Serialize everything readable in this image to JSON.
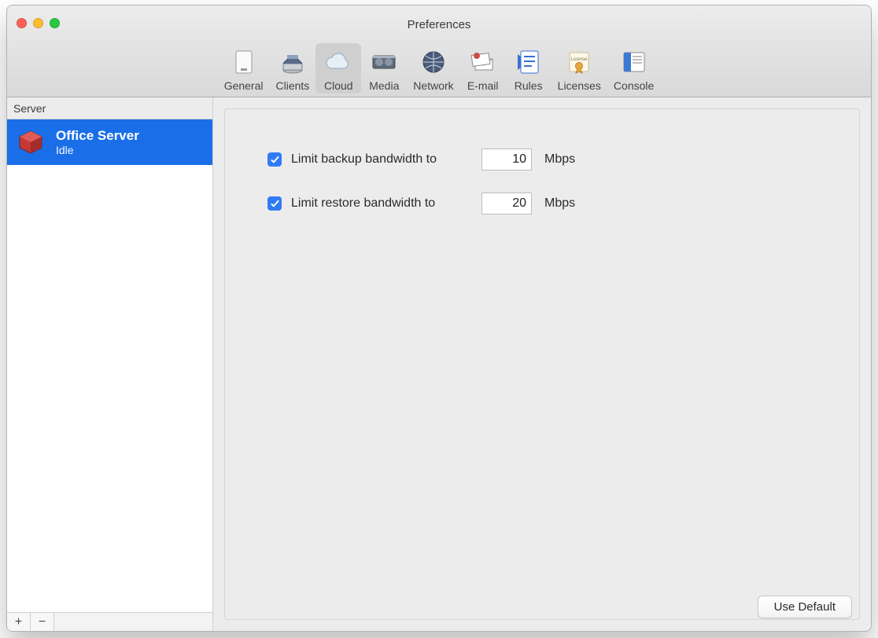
{
  "window": {
    "title": "Preferences"
  },
  "toolbar": {
    "items": [
      {
        "id": "general",
        "label": "General"
      },
      {
        "id": "clients",
        "label": "Clients"
      },
      {
        "id": "cloud",
        "label": "Cloud",
        "selected": true
      },
      {
        "id": "media",
        "label": "Media"
      },
      {
        "id": "network",
        "label": "Network"
      },
      {
        "id": "email",
        "label": "E-mail"
      },
      {
        "id": "rules",
        "label": "Rules"
      },
      {
        "id": "licenses",
        "label": "Licenses"
      },
      {
        "id": "console",
        "label": "Console"
      }
    ]
  },
  "sidebar": {
    "header": "Server",
    "servers": [
      {
        "name": "Office Server",
        "status": "Idle",
        "selected": true
      }
    ],
    "add_label": "+",
    "remove_label": "−"
  },
  "settings": {
    "backup": {
      "checked": true,
      "label": "Limit backup bandwidth to",
      "value": "10",
      "unit": "Mbps"
    },
    "restore": {
      "checked": true,
      "label": "Limit restore bandwidth to",
      "value": "20",
      "unit": "Mbps"
    }
  },
  "buttons": {
    "use_default": "Use Default"
  }
}
